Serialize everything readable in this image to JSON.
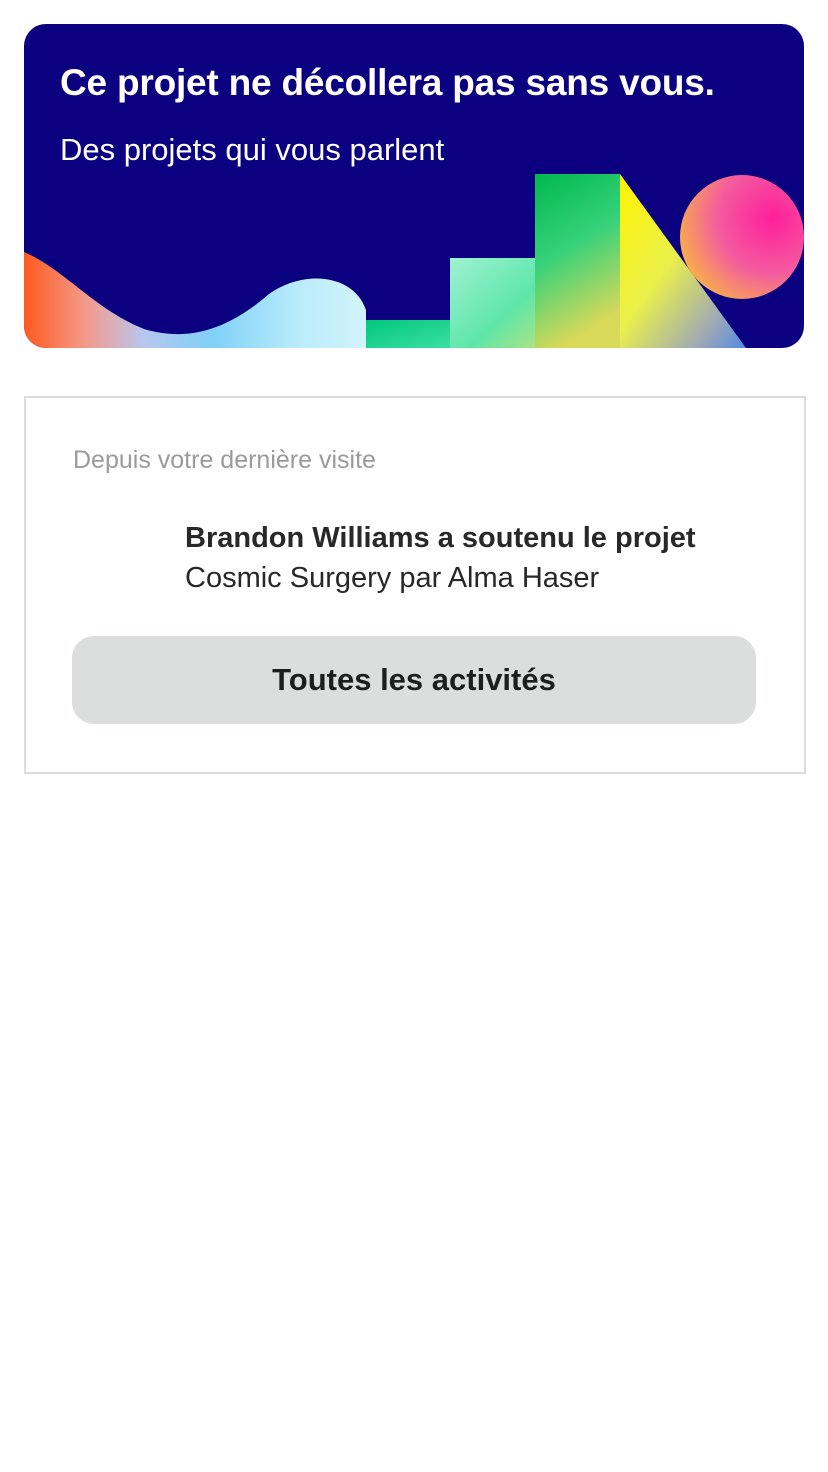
{
  "banner": {
    "title": "Ce projet ne décollera pas sans vous.",
    "subtitle": "Des projets qui vous parlent",
    "background_color": "#0a0080"
  },
  "activity": {
    "section_label": "Depuis votre dernière visite",
    "items": [
      {
        "headline": "Brandon Williams a soutenu le projet",
        "detail": "Cosmic Surgery par Alma Haser"
      }
    ],
    "button_label": "Toutes les activités"
  }
}
